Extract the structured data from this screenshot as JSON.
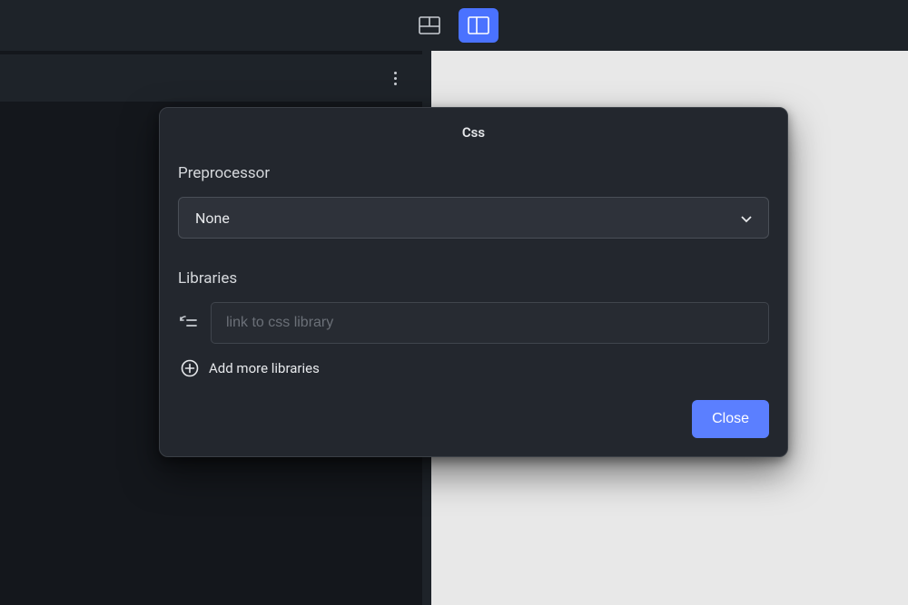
{
  "modal": {
    "title": "Css",
    "preprocessor_label": "Preprocessor",
    "preprocessor_value": "None",
    "libraries_label": "Libraries",
    "library_placeholder": "link to css library",
    "add_more_label": "Add more libraries",
    "close_label": "Close"
  }
}
